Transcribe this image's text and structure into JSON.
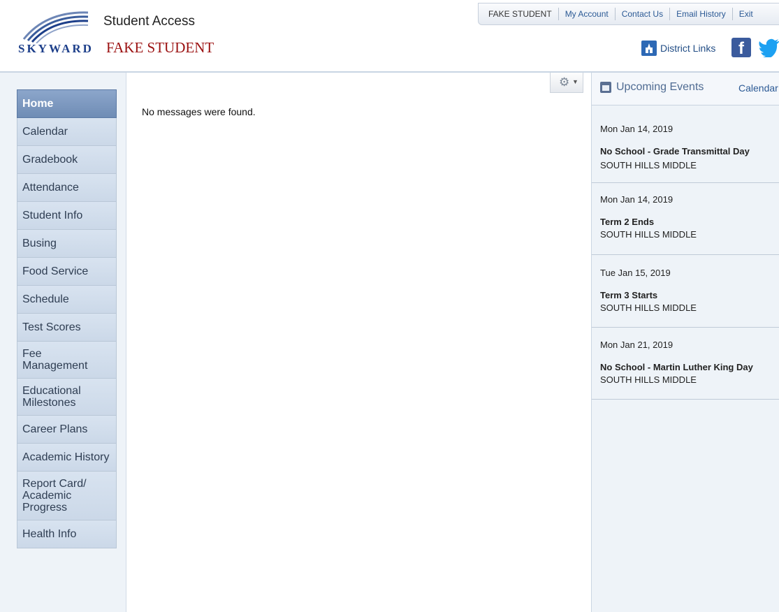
{
  "header": {
    "logo_word": "SKYWARD",
    "app_title": "Student Access",
    "student_name": "FAKE STUDENT"
  },
  "topnav": {
    "items": [
      "FAKE STUDENT",
      "My Account",
      "Contact Us",
      "Email History",
      "Exit"
    ]
  },
  "district_links": "District Links",
  "sidebar": {
    "items": [
      {
        "label": "Home",
        "active": true
      },
      {
        "label": "Calendar"
      },
      {
        "label": "Gradebook"
      },
      {
        "label": "Attendance"
      },
      {
        "label": "Student Info"
      },
      {
        "label": "Busing"
      },
      {
        "label": "Food Service"
      },
      {
        "label": "Schedule"
      },
      {
        "label": "Test Scores"
      },
      {
        "label": "Fee\nManagement"
      },
      {
        "label": "Educational\nMilestones"
      },
      {
        "label": "Career Plans"
      },
      {
        "label": "Academic History"
      },
      {
        "label": "Report Card/\nAcademic\nProgress"
      },
      {
        "label": "Health Info"
      }
    ]
  },
  "main": {
    "empty_message": "No messages were found."
  },
  "events": {
    "title": "Upcoming Events",
    "calendar_link": "Calendar",
    "items": [
      {
        "date": "Mon Jan 14, 2019",
        "title": "No School - Grade Transmittal Day",
        "school": "SOUTH HILLS MIDDLE"
      },
      {
        "date": "Mon Jan 14, 2019",
        "title": "Term 2 Ends",
        "school": "SOUTH HILLS MIDDLE"
      },
      {
        "date": "Tue Jan 15, 2019",
        "title": "Term 3 Starts",
        "school": "SOUTH HILLS MIDDLE"
      },
      {
        "date": "Mon Jan 21, 2019",
        "title": "No School - Martin Luther King Day",
        "school": "SOUTH HILLS MIDDLE"
      }
    ]
  },
  "colors": {
    "brand_blue": "#1d3f8a",
    "student_name_red": "#9b1111",
    "active_nav": "#7b96bd"
  }
}
